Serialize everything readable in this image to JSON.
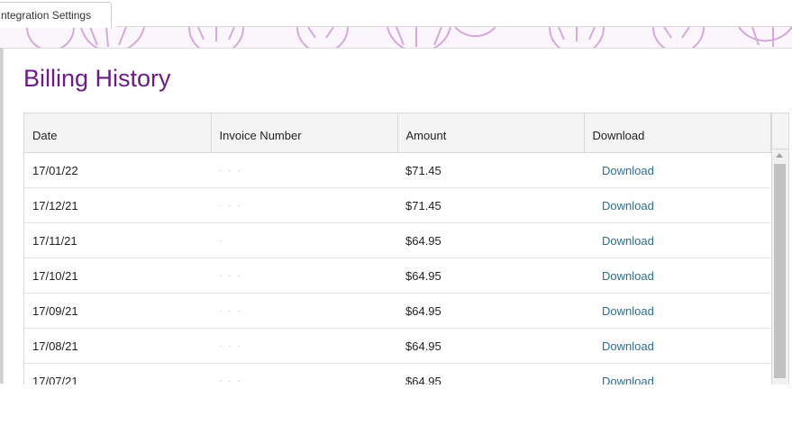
{
  "tab": {
    "label": "ntegration Settings"
  },
  "modal": {
    "title": "Billing History",
    "columns": [
      "Date",
      "Invoice Number",
      "Amount",
      "Download"
    ],
    "rows": [
      {
        "date": "17/01/22",
        "invoice": "· · ·",
        "amount": "$71.45",
        "download": "Download"
      },
      {
        "date": "17/12/21",
        "invoice": "· · ·",
        "amount": "$71.45",
        "download": "Download"
      },
      {
        "date": "17/11/21",
        "invoice": "·",
        "amount": "$64.95",
        "download": "Download"
      },
      {
        "date": "17/10/21",
        "invoice": "· · ·",
        "amount": "$64.95",
        "download": "Download"
      },
      {
        "date": "17/09/21",
        "invoice": "· · ·",
        "amount": "$64.95",
        "download": "Download"
      },
      {
        "date": "17/08/21",
        "invoice": "· · ·",
        "amount": "$64.95",
        "download": "Download"
      },
      {
        "date": "17/07/21",
        "invoice": "· · ·",
        "amount": "$64.95",
        "download": "Download"
      }
    ]
  },
  "colors": {
    "title": "#6b1c86",
    "link": "#2f6e8f",
    "pattern": "#d6a8de"
  },
  "icons": [
    "gear-icon",
    "scroll-up-icon"
  ]
}
